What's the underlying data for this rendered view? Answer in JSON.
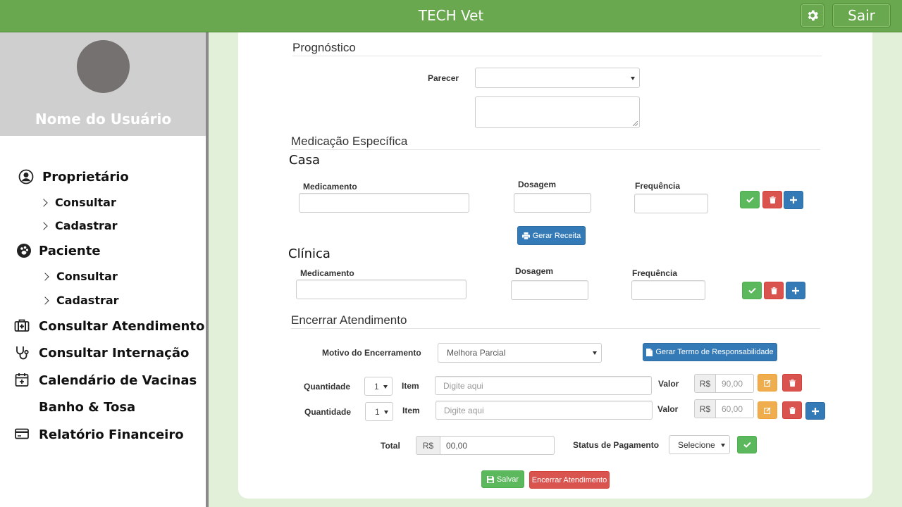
{
  "app": {
    "title": "TECH Vet",
    "exit_label": "Sair"
  },
  "user": {
    "name": "Nome do Usuário"
  },
  "sidebar": {
    "owner": {
      "label": "Proprietário",
      "consult": "Consultar",
      "register": "Cadastrar"
    },
    "patient": {
      "label": "Paciente",
      "consult": "Consultar",
      "register": "Cadastrar"
    },
    "items": [
      {
        "label": "Consultar  Atendimento",
        "icon": "first-aid-kit-icon"
      },
      {
        "label": "Consultar  Internação",
        "icon": "stethoscope-icon"
      },
      {
        "label": "Calendário  de Vacinas",
        "icon": "calendar-plus-icon"
      },
      {
        "label": "Banho  &  Tosa",
        "icon": ""
      },
      {
        "label": "Relatório  Financeiro",
        "icon": "credit-card-icon"
      }
    ]
  },
  "prognosis": {
    "title": "Prognóstico",
    "opinion_label": "Parecer",
    "opinion_value": "",
    "notes_value": ""
  },
  "medication": {
    "title": "Medicação Específica",
    "home": {
      "title": "Casa",
      "medicine_label": "Medicamento",
      "dosage_label": "Dosagem",
      "frequency_label": "Frequência",
      "prescription_button": "Gerar Receita"
    },
    "clinic": {
      "title": "Clínica",
      "medicine_label": "Medicamento",
      "dosage_label": "Dosagem",
      "frequency_label": "Frequência"
    }
  },
  "closing": {
    "title": "Encerrar Atendimento",
    "reason_label": "Motivo do Encerramento",
    "reason_value": "Melhora Parcial",
    "term_button": "Gerar Termo de Responsabilidade",
    "rows": [
      {
        "qty_label": "Quantidade",
        "qty": "1",
        "item_label": "Item",
        "item_placeholder": "Digite aqui",
        "value_label": "Valor",
        "currency": "R$",
        "value": "90,00"
      },
      {
        "qty_label": "Quantidade",
        "qty": "1",
        "item_label": "Item",
        "item_placeholder": "Digite aqui",
        "value_label": "Valor",
        "currency": "R$",
        "value": "60,00"
      }
    ],
    "total_label": "Total",
    "total_currency": "R$",
    "total_value": "00,00",
    "payment_status_label": "Status de Pagamento",
    "payment_status_value": "Selecione",
    "save_button": "Salvar",
    "close_button": "Encerrar Atendimento"
  },
  "colors": {
    "topbar": "#6aa84f",
    "background": "#e2efd9",
    "success": "#5cb85c",
    "danger": "#d9534f",
    "primary": "#337ab7",
    "warning": "#f0ad4e"
  }
}
